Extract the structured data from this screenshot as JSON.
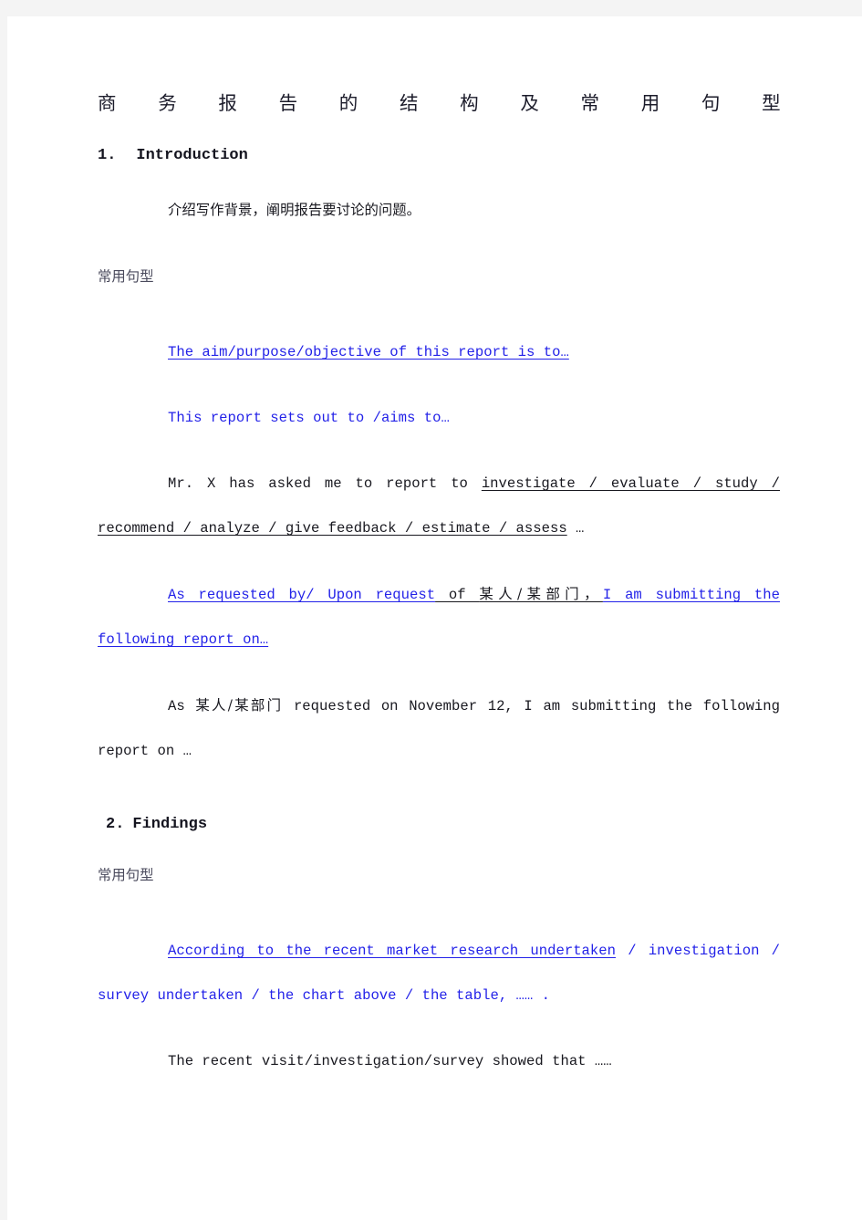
{
  "page": {
    "background": "#f4f4f4",
    "sheet_color": "#ffffff",
    "text_color": "#18181f",
    "accent_color": "#2322e8",
    "muted_color": "#4a4a5c"
  },
  "title": {
    "full": "商务报告的结构及常用句型",
    "chars": [
      "商",
      "务",
      "报",
      "告",
      "的",
      "结",
      "构",
      "及",
      "常",
      "用",
      "句",
      "型"
    ]
  },
  "sections": [
    {
      "number": "1.",
      "heading": "Introduction",
      "description_cn": "介绍写作背景，阐明报告要讨论的问题。",
      "common_patterns_label": "常用句型",
      "examples": [
        {
          "id": "aim-purpose",
          "runs": [
            {
              "text": "The aim/purpose/objective of this report is to…",
              "color": "blue",
              "underline": true
            }
          ]
        },
        {
          "id": "sets-out-to",
          "runs": [
            {
              "text": "This report sets out to /aims to…",
              "color": "blue",
              "underline": false
            }
          ]
        },
        {
          "id": "mr-x-asked",
          "runs": [
            {
              "text": "Mr. X has asked me to report to ",
              "color": "black",
              "underline": false
            },
            {
              "text": "investigate / evaluate / study / recommend / analyze / give feedback / estimate / assess",
              "color": "black",
              "underline": true
            },
            {
              "text": " …",
              "color": "black",
              "underline": false
            }
          ]
        },
        {
          "id": "as-requested",
          "runs": [
            {
              "text": "As requested by/ Upon request",
              "color": "blue",
              "underline": true
            },
            {
              "text": " of ",
              "color": "black",
              "underline": true
            },
            {
              "text": "某人/某部门，",
              "color": "black",
              "underline": true,
              "cjk": true
            },
            {
              "text": "I am submitting the following report on…",
              "color": "blue",
              "underline": true
            }
          ]
        },
        {
          "id": "as-requested-date",
          "runs": [
            {
              "text": "As ",
              "color": "black",
              "underline": false
            },
            {
              "text": "某人/某部门",
              "color": "black",
              "underline": false,
              "cjk": true
            },
            {
              "text": " requested on November 12, I am submitting the following report on …",
              "color": "black",
              "underline": false
            }
          ]
        }
      ]
    },
    {
      "number": "2.",
      "heading": "Findings",
      "common_patterns_label": "常用句型",
      "examples": [
        {
          "id": "according-to-research",
          "runs": [
            {
              "text": "According to the recent market research undertaken",
              "color": "blue",
              "underline": true
            },
            {
              "text": " / investigation / survey undertaken / the chart above / the table, …… .",
              "color": "blue",
              "underline": false
            }
          ]
        },
        {
          "id": "recent-visit-showed",
          "runs": [
            {
              "text": "The recent visit/investigation/survey showed that ……",
              "color": "black",
              "underline": false
            }
          ]
        }
      ]
    }
  ]
}
